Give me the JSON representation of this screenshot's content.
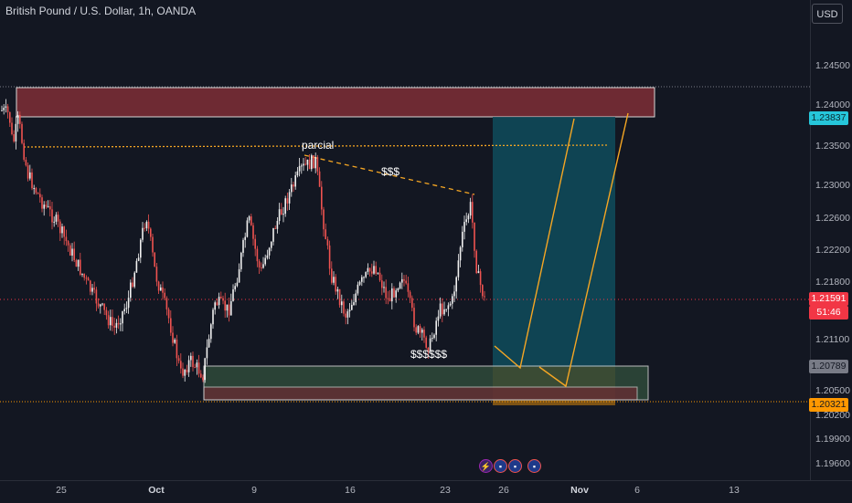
{
  "header": {
    "title": "British Pound / U.S. Dollar, 1h, OANDA",
    "currency_button": "USD"
  },
  "price_axis": {
    "labels": [
      "1.24500",
      "1.24000",
      "1.23500",
      "1.23000",
      "1.22600",
      "1.22200",
      "1.21800",
      "1.21100",
      "1.20500",
      "1.20200",
      "1.19900",
      "1.19600"
    ],
    "last_price_tag": "1.21591",
    "countdown_tag": "51:46",
    "target_tag": "1.23837",
    "entry_tag": "1.20789",
    "stop_tag": "1.20321"
  },
  "time_axis": {
    "labels": [
      "25",
      "Oct",
      "9",
      "16",
      "23",
      "26",
      "Nov",
      "6",
      "13"
    ]
  },
  "annotations": {
    "partial": "parcial",
    "liquidity_top": "$$$",
    "liquidity_bottom": "$$$$$$"
  },
  "events": {
    "icons": [
      "lightning-event-icon",
      "us-flag-event-icon",
      "us-flag-event-icon",
      "us-flag-event-icon"
    ]
  },
  "colors": {
    "background": "#131722",
    "up": "#f0f0f0",
    "down": "#ef5350",
    "target_tag": "#26c6da",
    "last_price_tag": "#f23645",
    "entry_tag": "#787b86",
    "stop_tag": "#ff9800",
    "supply_zone": "#6e2a33",
    "demand_zone": "#2f4a3a",
    "long_profit_zone": "#0f4c5c",
    "long_stop_zone": "#8a5a14",
    "projection_lines": "#f5a623"
  }
}
